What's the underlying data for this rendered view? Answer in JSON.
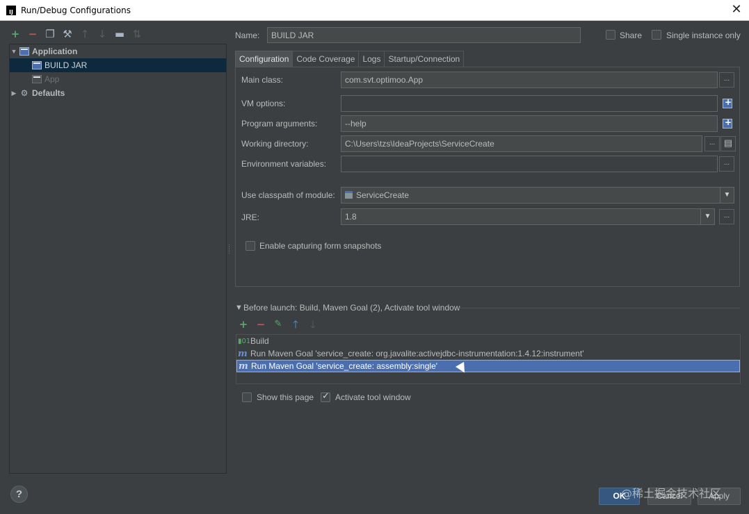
{
  "window": {
    "title": "Run/Debug Configurations",
    "app_icon": "IJ",
    "close_glyph": "✕"
  },
  "toolbar": {
    "icons": [
      "add-icon",
      "remove-icon",
      "copy-icon",
      "edit-defaults-icon",
      "move-up-icon",
      "move-down-icon",
      "folder-icon",
      "sort-icon"
    ]
  },
  "tree": {
    "application": "Application",
    "build_jar": "BUILD JAR",
    "app": "App",
    "defaults": "Defaults"
  },
  "header": {
    "name_label": "Name:",
    "name_value": "BUILD JAR",
    "share_label": "Share",
    "single_instance_label": "Single instance only"
  },
  "tabs": [
    "Configuration",
    "Code Coverage",
    "Logs",
    "Startup/Connection"
  ],
  "form": {
    "main_class_label": "Main class:",
    "main_class_value": "com.svt.optimoo.App",
    "vm_options_label": "VM options:",
    "vm_options_value": "",
    "program_args_label": "Program arguments:",
    "program_args_value": "--help",
    "working_dir_label": "Working directory:",
    "working_dir_value": "C:\\Users\\tzs\\IdeaProjects\\ServiceCreate",
    "env_vars_label": "Environment variables:",
    "env_vars_value": "",
    "classpath_label": "Use classpath of module:",
    "classpath_value": "ServiceCreate",
    "jre_label": "JRE:",
    "jre_value": "1.8",
    "snapshots_label": "Enable capturing form snapshots",
    "dots": "..."
  },
  "before_launch": {
    "title": "Before launch: Build, Maven Goal (2), Activate tool window",
    "items": [
      "Build",
      "Run Maven Goal 'service_create: org.javalite:activejdbc-instrumentation:1.4.12:instrument'",
      "Run Maven Goal 'service_create: assembly:single'"
    ]
  },
  "options": {
    "show_page_label": "Show this page",
    "activate_tool_label": "Activate tool window"
  },
  "buttons": {
    "ok": "OK",
    "cancel": "Cancel",
    "apply": "Apply",
    "help": "?"
  },
  "watermark": "@稀土掘金技术社区"
}
